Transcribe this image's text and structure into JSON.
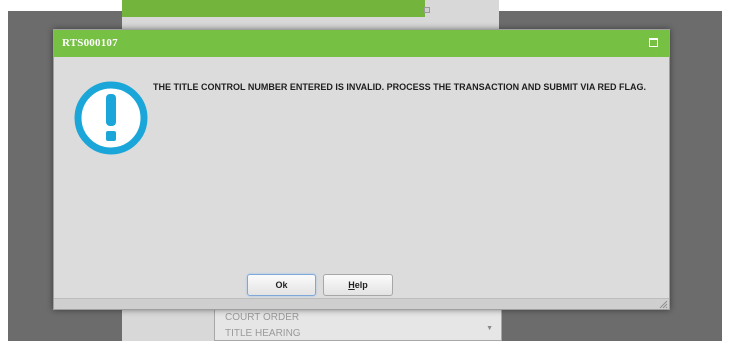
{
  "dialog": {
    "title": "RTS000107",
    "message": "THE TITLE CONTROL NUMBER ENTERED IS INVALID. PROCESS THE TRANSACTION AND SUBMIT VIA RED FLAG.",
    "icon": "exclamation-circle-icon",
    "buttons": {
      "ok": "Ok",
      "help_mnemonic": "H",
      "help_rest": "elp"
    }
  },
  "background": {
    "select_items": [
      "COURT ORDER",
      "TITLE HEARING"
    ]
  },
  "colors": {
    "titlebar": "#76c043",
    "dialog_body": "#dcdcdc",
    "icon": "#1aa6d8",
    "backdrop": "#6c6c6c"
  }
}
